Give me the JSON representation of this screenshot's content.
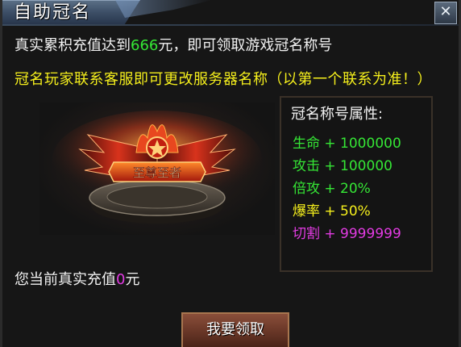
{
  "window": {
    "title": "自助冠名",
    "close_label": "✕"
  },
  "info": {
    "line1_prefix": "真实累积充值达到",
    "line1_amount": "666",
    "line1_suffix": "元，即可领取游戏冠名称号",
    "line2": "冠名玩家联系客服即可更改服务器名称（以第一个联系为准！）"
  },
  "banner": {
    "emblem_text": "至尊至者"
  },
  "attributes": {
    "title": "冠名称号属性:",
    "items": [
      {
        "label": "生命 + 1000000",
        "color": "#35e635"
      },
      {
        "label": "攻击 + 100000",
        "color": "#35e635"
      },
      {
        "label": "倍攻 + 20%",
        "color": "#35e635"
      },
      {
        "label": "爆率 + 50%",
        "color": "#f5ef1c"
      },
      {
        "label": "切割 + 9999999",
        "color": "#e23be2"
      }
    ]
  },
  "recharge": {
    "prefix": "您当前真实充值",
    "value": "0",
    "suffix": "元"
  },
  "claim_button": {
    "label": "我要领取"
  },
  "colors": {
    "accent_green": "#35e635",
    "accent_yellow": "#f5ef1c",
    "accent_magenta": "#e23be2"
  }
}
